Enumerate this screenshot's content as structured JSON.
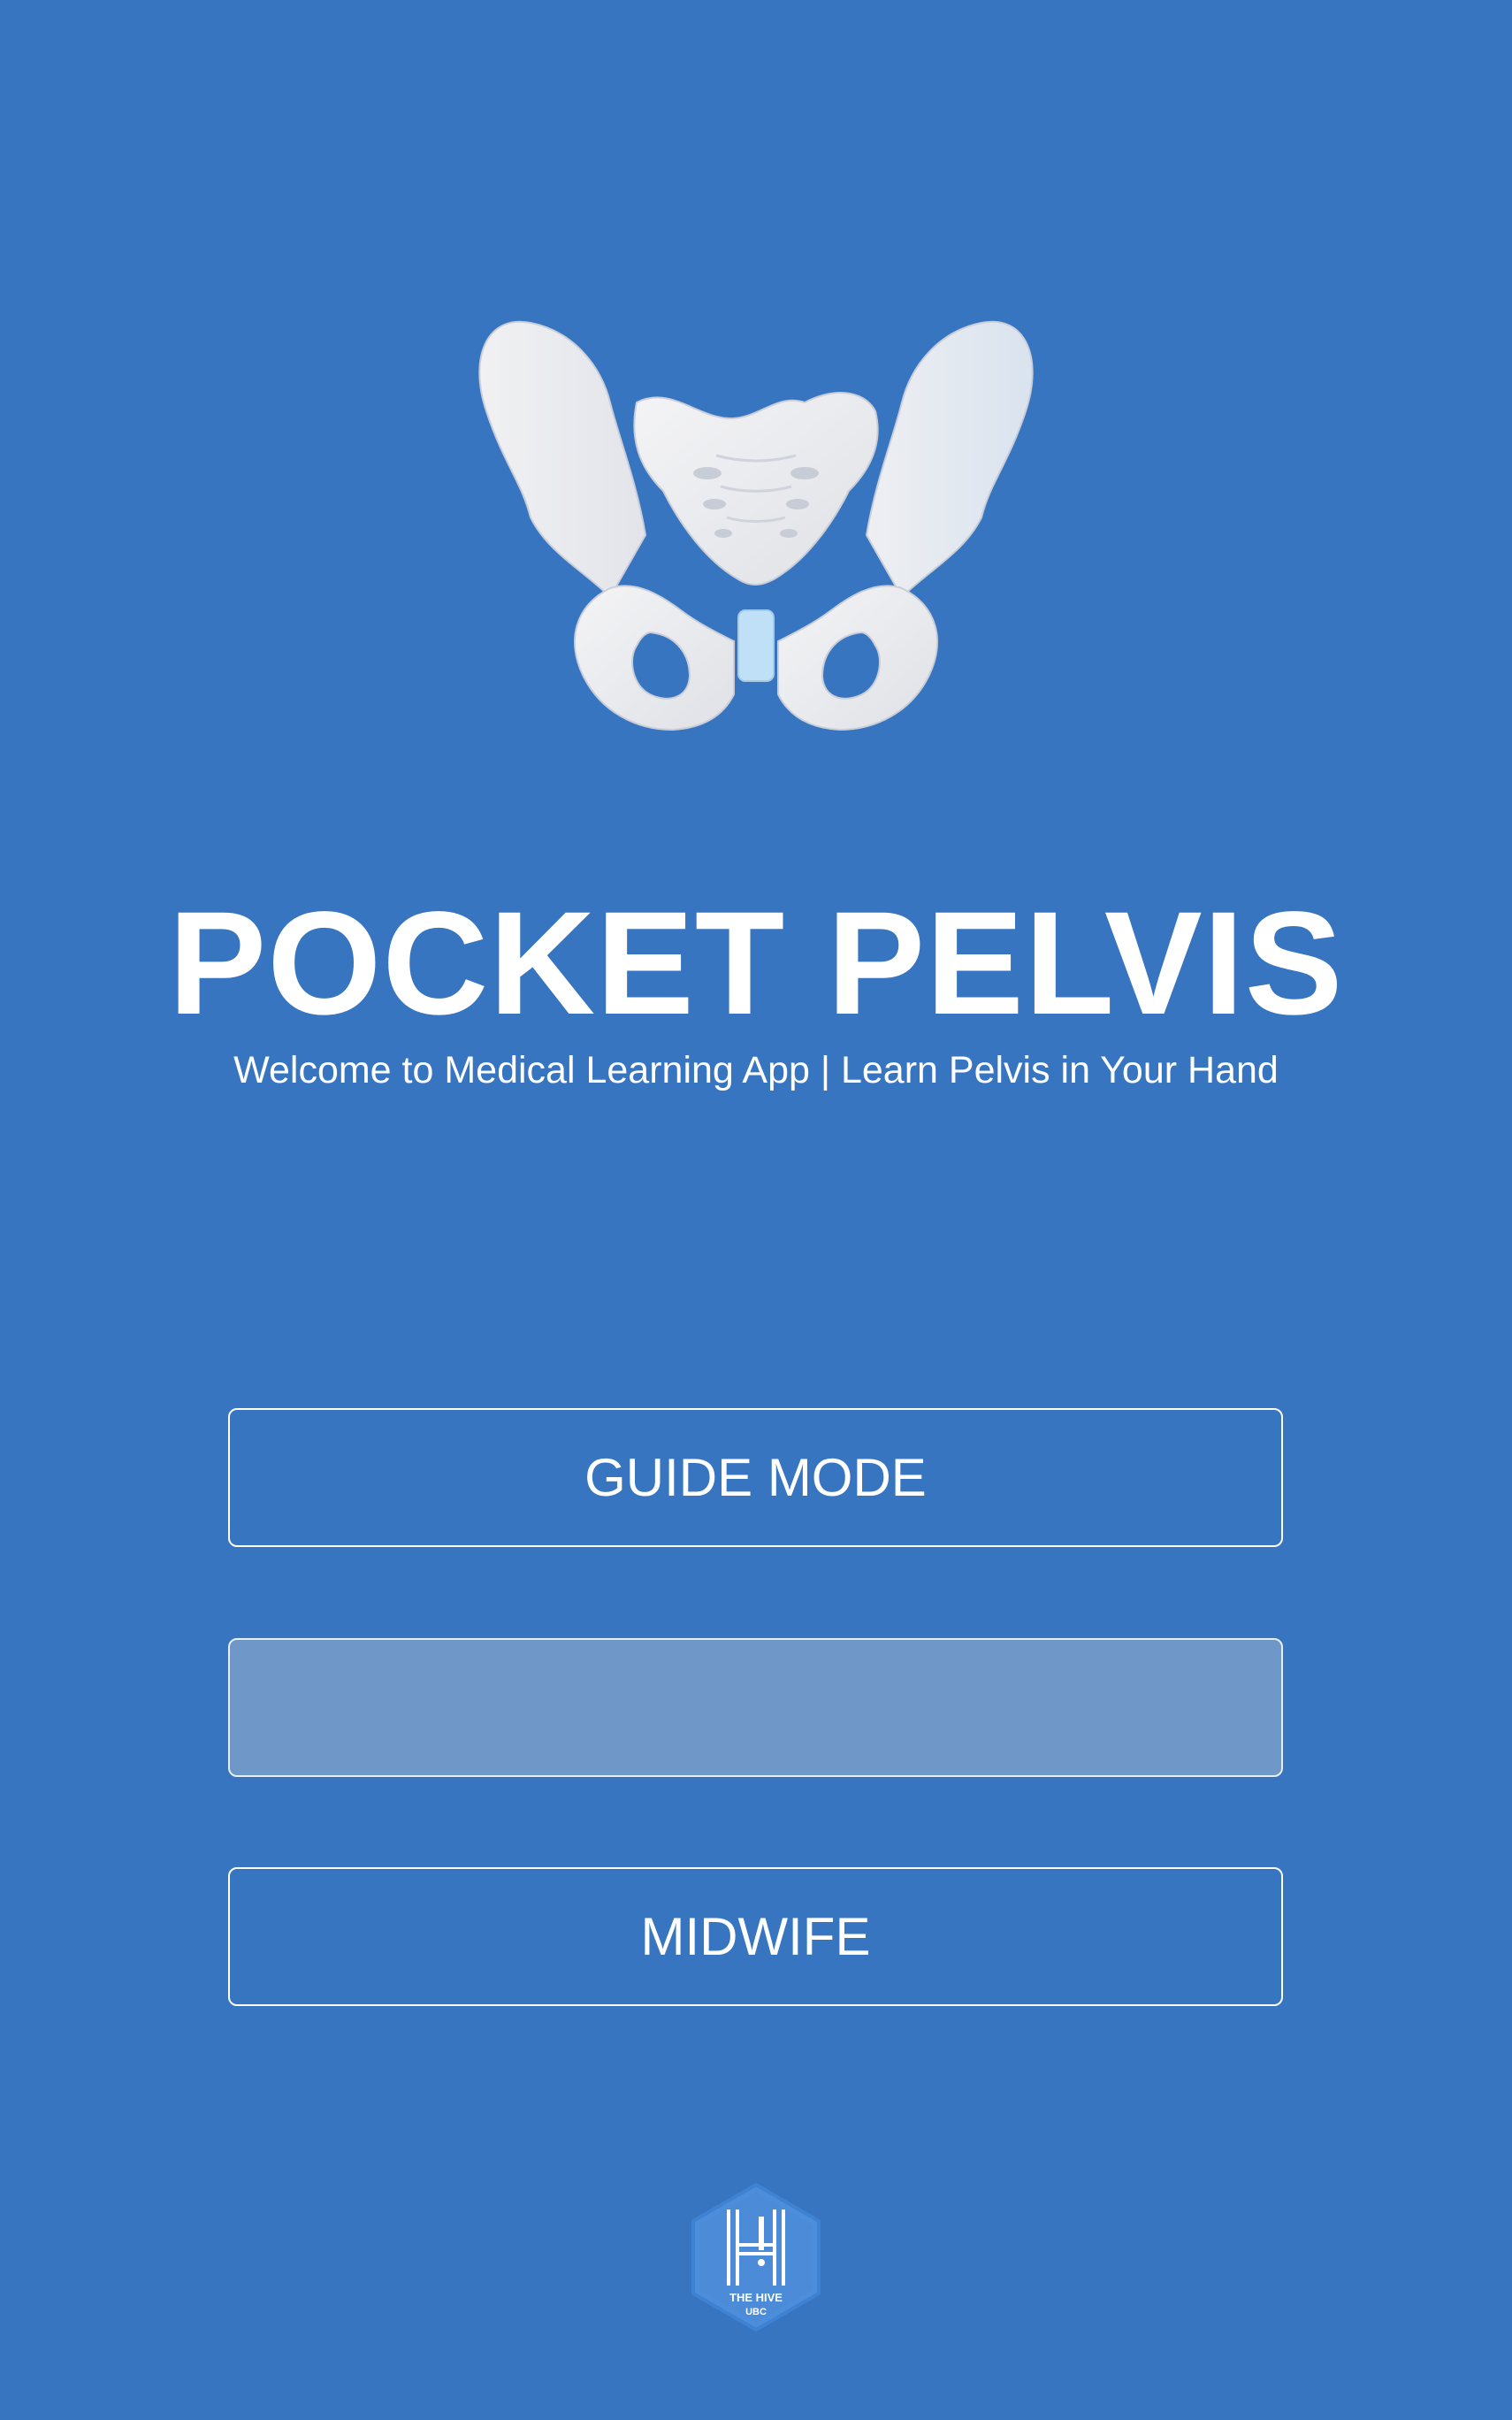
{
  "app": {
    "title": "POCKET PELVIS",
    "subtitle": "Welcome to Medical Learning App | Learn Pelvis in Your Hand"
  },
  "menu": {
    "guide_mode_label": "GUIDE MODE",
    "second_button_label": "",
    "midwife_label": "MIDWIFE"
  },
  "footer": {
    "logo_name": "THE HIVE",
    "logo_sub": "UBC"
  },
  "colors": {
    "background": "#3775c1",
    "button_border": "#ffffff",
    "disabled_button_fill": "#6f98c8",
    "logo_fill": "#4d8edc"
  },
  "icons": {
    "hero": "pelvis-icon",
    "footer": "hive-logo"
  }
}
